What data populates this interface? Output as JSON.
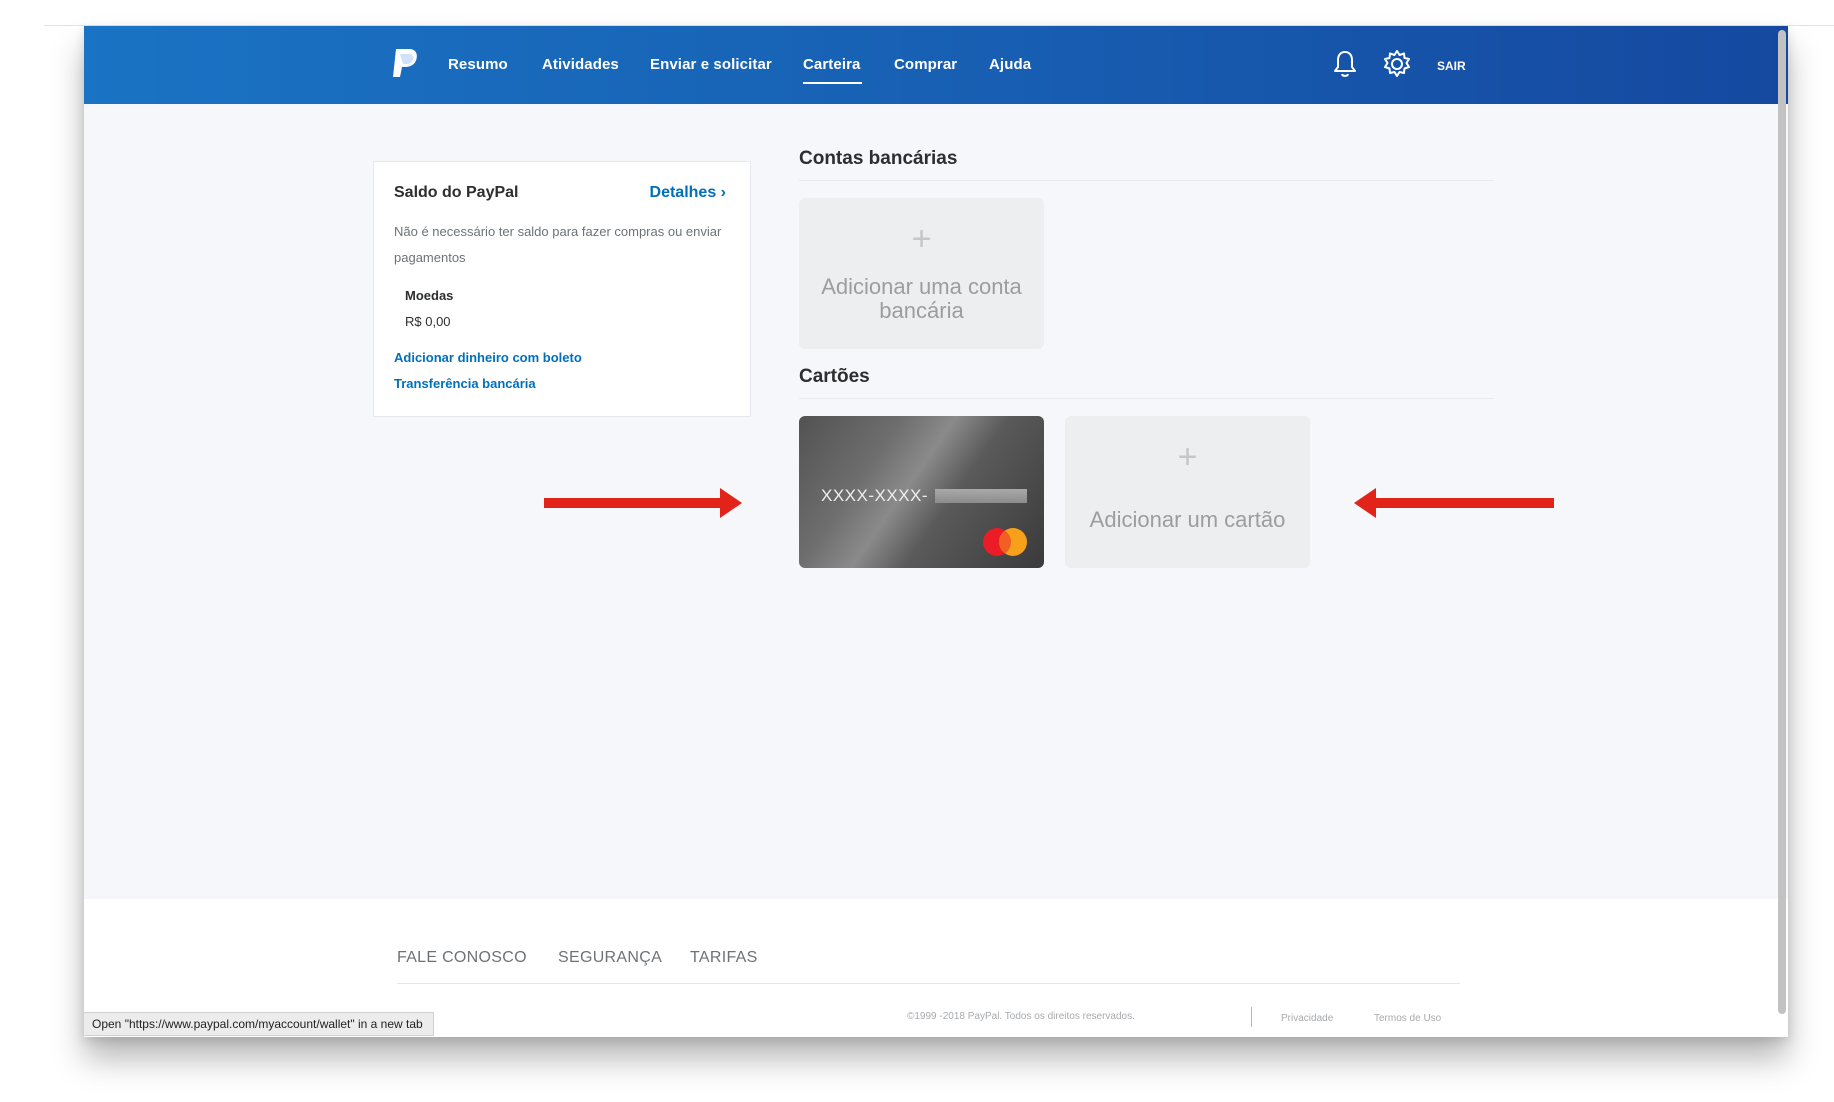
{
  "nav": {
    "items": [
      "Resumo",
      "Atividades",
      "Enviar e solicitar",
      "Carteira",
      "Comprar",
      "Ajuda"
    ],
    "active": "Carteira",
    "logout": "SAIR",
    "icons": [
      "paypal-logo",
      "bell-icon",
      "gear-icon"
    ]
  },
  "balance": {
    "title": "Saldo do PayPal",
    "details_link": "Detalhes",
    "description": "Não é necessário ter saldo para fazer compras ou enviar pagamentos",
    "currency_label": "Moedas",
    "currency_value": "R$ 0,00",
    "links": [
      "Adicionar dinheiro com boleto",
      "Transferência bancária"
    ]
  },
  "bank_accounts": {
    "title": "Contas bancárias",
    "add_label": "Adicionar uma conta bancária"
  },
  "cards": {
    "title": "Cartões",
    "card_number": "XXXX-XXXX-",
    "card_brand": "MasterCard",
    "add_label": "Adicionar um cartão"
  },
  "footer": {
    "links": [
      "FALE CONOSCO",
      "SEGURANÇA",
      "TARIFAS"
    ],
    "copyright": "©1999 -2018 PayPal. Todos os direitos reservados.",
    "privacy": "Privacidade",
    "terms": "Termos de Uso"
  },
  "status_bar": {
    "text": "Open \"https://www.paypal.com/myaccount/wallet\" in a new tab"
  },
  "colors": {
    "header_start": "#1a73c4",
    "header_end": "#1549a0",
    "link": "#0070ba",
    "arrow": "#e2231a"
  }
}
